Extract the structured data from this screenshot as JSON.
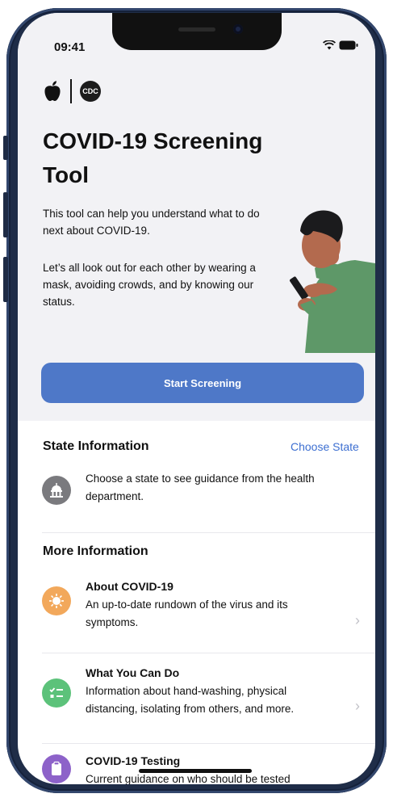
{
  "status_bar": {
    "time": "09:41"
  },
  "logos": {
    "apple": "apple-icon",
    "cdc_text": "CDC"
  },
  "hero": {
    "title": "COVID-19 Screening Tool",
    "intro": "This tool can help you understand what to do next about COVID-19.",
    "reminder": "Let’s all look out for each other by wearing a mask, avoiding crowds, and by knowing our status.",
    "start_button": "Start Screening"
  },
  "state_info": {
    "heading": "State Information",
    "choose_link": "Choose State",
    "icon": "capitol-building-icon",
    "description": "Choose a state to see guidance from the health department."
  },
  "more_info": {
    "heading": "More Information",
    "items": [
      {
        "title": "About COVID-19",
        "description": "An up-to-date rundown of the virus and its symptoms.",
        "icon": "virus-icon",
        "color": "#f2a85b"
      },
      {
        "title": "What You Can Do",
        "description": "Information about hand-washing, physical distancing, isolating from others, and more.",
        "icon": "checklist-icon",
        "color": "#5cc27a"
      },
      {
        "title": "COVID-19 Testing",
        "description": "Current guidance on who should be tested",
        "icon": "clipboard-icon",
        "color": "#8d62c9"
      }
    ]
  },
  "colors": {
    "accent": "#4e78c8",
    "link": "#3d6fd1",
    "frame": "#1f2d48"
  }
}
